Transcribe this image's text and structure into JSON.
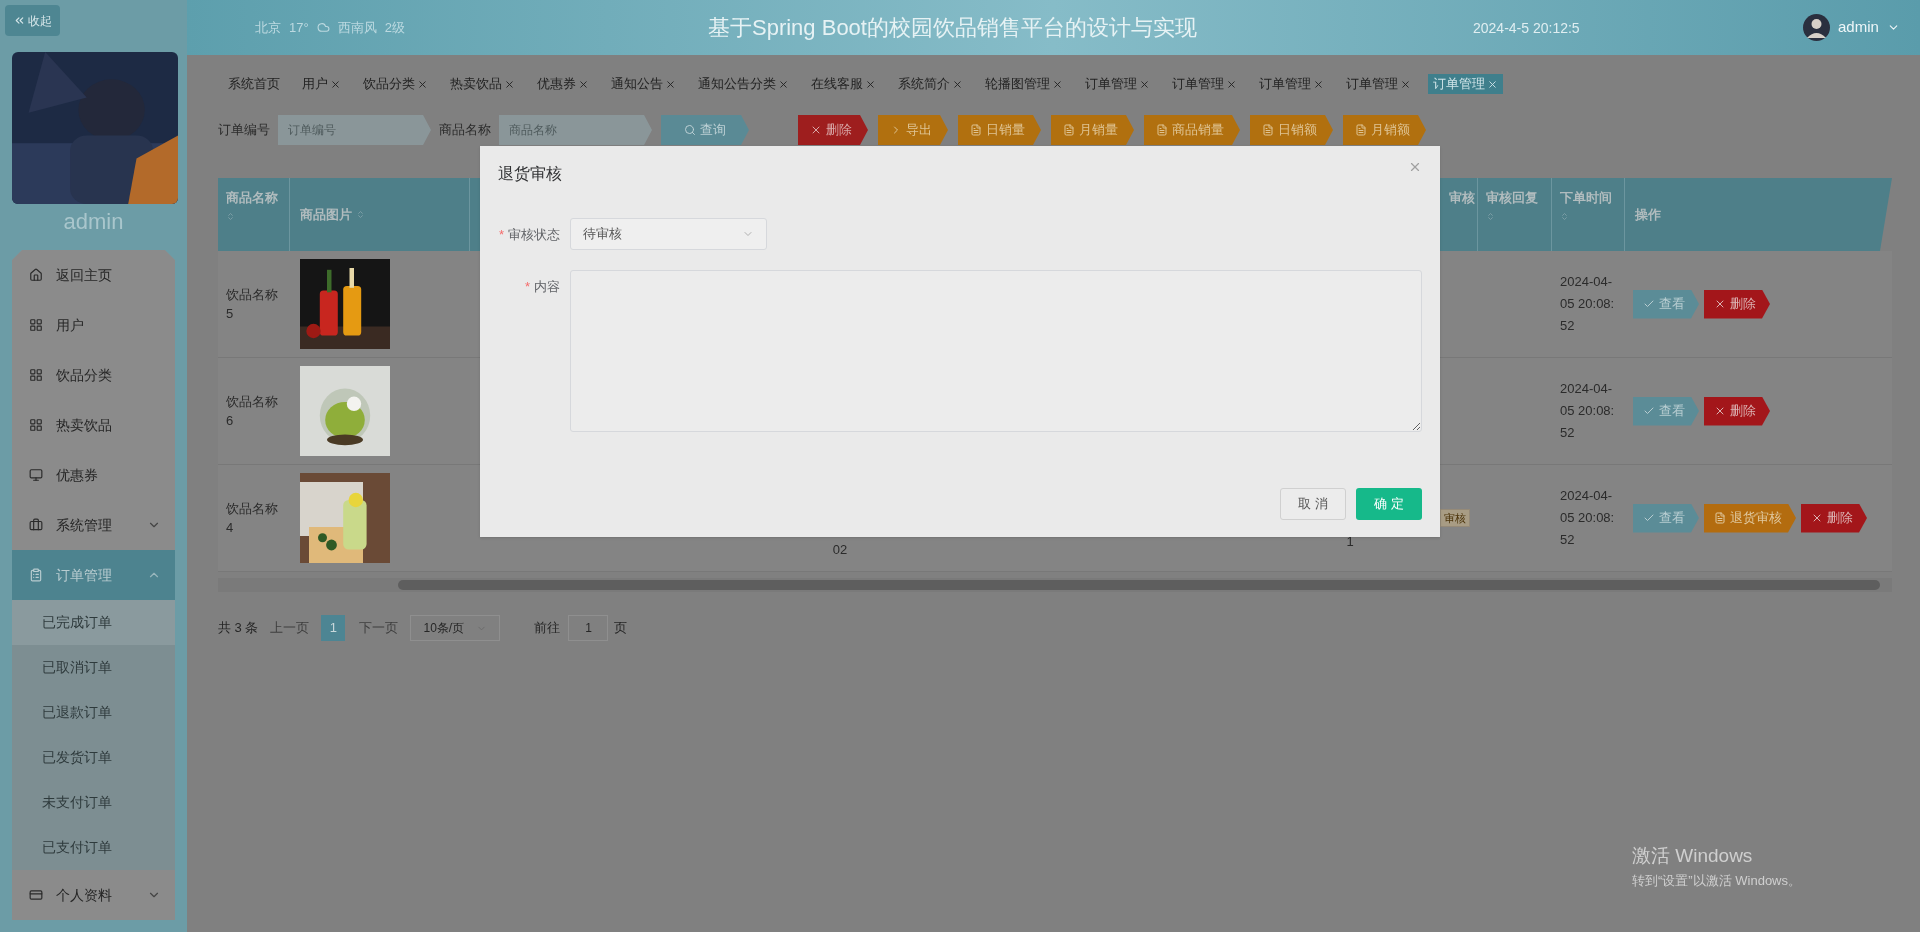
{
  "sidebar": {
    "collapse_label": "收起",
    "avatar": {
      "kind": "picture"
    },
    "username": "admin",
    "menu": [
      {
        "label": "返回主页",
        "kind": "link",
        "selected": false
      },
      {
        "label": "用户",
        "kind": "link",
        "selected": false
      },
      {
        "label": "饮品分类",
        "kind": "link",
        "selected": false
      },
      {
        "label": "热卖饮品",
        "kind": "link",
        "selected": false
      },
      {
        "label": "优惠券",
        "kind": "link",
        "selected": false
      },
      {
        "label": "系统管理",
        "kind": "group",
        "selected": false,
        "expanded": false
      },
      {
        "label": "订单管理",
        "kind": "group",
        "selected": true,
        "expanded": true,
        "children": [
          {
            "label": "已完成订单",
            "selected": true
          },
          {
            "label": "已取消订单",
            "selected": false
          },
          {
            "label": "已退款订单",
            "selected": false
          },
          {
            "label": "已发货订单",
            "selected": false
          },
          {
            "label": "未支付订单",
            "selected": false
          },
          {
            "label": "已支付订单",
            "selected": false
          }
        ]
      },
      {
        "label": "个人资料",
        "kind": "group",
        "selected": false,
        "expanded": false
      }
    ]
  },
  "header": {
    "weather": {
      "city": "北京",
      "temperature": "17°",
      "wind": "西南风",
      "wind_level": "2级"
    },
    "title": "基于Spring Boot的校园饮品销售平台的设计与实现",
    "datetime": "2024-4-5 20:12:5",
    "user": "admin"
  },
  "tags": [
    {
      "label": "系统首页",
      "closable": false,
      "selected": false
    },
    {
      "label": "用户",
      "closable": true,
      "selected": false
    },
    {
      "label": "饮品分类",
      "closable": true,
      "selected": false
    },
    {
      "label": "热卖饮品",
      "closable": true,
      "selected": false
    },
    {
      "label": "优惠券",
      "closable": true,
      "selected": false
    },
    {
      "label": "通知公告",
      "closable": true,
      "selected": false
    },
    {
      "label": "通知公告分类",
      "closable": true,
      "selected": false
    },
    {
      "label": "在线客服",
      "closable": true,
      "selected": false
    },
    {
      "label": "系统简介",
      "closable": true,
      "selected": false
    },
    {
      "label": "轮播图管理",
      "closable": true,
      "selected": false
    },
    {
      "label": "订单管理",
      "closable": true,
      "selected": false
    },
    {
      "label": "订单管理",
      "closable": true,
      "selected": false
    },
    {
      "label": "订单管理",
      "closable": true,
      "selected": false
    },
    {
      "label": "订单管理",
      "closable": true,
      "selected": false
    },
    {
      "label": "订单管理",
      "closable": true,
      "selected": true
    }
  ],
  "search": {
    "fields": [
      {
        "label": "订单编号",
        "placeholder": "订单编号"
      },
      {
        "label": "商品名称",
        "placeholder": "商品名称"
      }
    ],
    "button": "查询"
  },
  "toolbar": [
    {
      "label": "删除",
      "kind": "delete"
    },
    {
      "label": "导出",
      "kind": "export"
    },
    {
      "label": "日销量",
      "kind": "report"
    },
    {
      "label": "月销量",
      "kind": "report"
    },
    {
      "label": "商品销量",
      "kind": "report"
    },
    {
      "label": "日销额",
      "kind": "report"
    },
    {
      "label": "月销额",
      "kind": "report"
    }
  ],
  "table": {
    "columns": [
      {
        "label": "商品名称"
      },
      {
        "label": "商品图片"
      },
      {
        "label": "审核"
      },
      {
        "label": "审核回复"
      },
      {
        "label": "下单时间"
      },
      {
        "label": "操作"
      }
    ],
    "rows": [
      {
        "name": "饮品名称5",
        "image": {
          "kind": "picture"
        },
        "time": "2024-04-05 20:08:52",
        "actions": [
          {
            "label": "查看",
            "kind": "view"
          },
          {
            "label": "删除",
            "kind": "delete"
          }
        ]
      },
      {
        "name": "饮品名称6",
        "image": {
          "kind": "picture"
        },
        "time": "2024-04-05 20:08:52",
        "actions": [
          {
            "label": "查看",
            "kind": "view"
          },
          {
            "label": "删除",
            "kind": "delete"
          }
        ]
      },
      {
        "name": "饮品名称4",
        "image": {
          "kind": "picture"
        },
        "column_4": "02",
        "column_6": "1",
        "status_tag": "审核",
        "time": "2024-04-05 20:08:52",
        "actions": [
          {
            "label": "查看",
            "kind": "view"
          },
          {
            "label": "退货审核",
            "kind": "review"
          },
          {
            "label": "删除",
            "kind": "delete"
          }
        ]
      }
    ]
  },
  "pagination": {
    "total": "共 3 条",
    "prev": "上一页",
    "pages": [
      {
        "label": "1",
        "selected": true
      }
    ],
    "next": "下一页",
    "page_size": "10条/页",
    "goto_label": "前往",
    "goto_value": "1",
    "goto_suffix": "页"
  },
  "dialog": {
    "title": "退货审核",
    "fields": [
      {
        "label": "审核状态",
        "required_mark": "*",
        "kind": "select",
        "value": "待审核"
      },
      {
        "label": "内容",
        "required_mark": "*",
        "kind": "textarea"
      }
    ],
    "buttons": [
      {
        "label": "取 消",
        "kind": "default"
      },
      {
        "label": "确 定",
        "kind": "primary"
      }
    ]
  },
  "os_notice": {
    "title": "激活 Windows",
    "subtitle": "转到“设置”以激活 Windows。"
  }
}
